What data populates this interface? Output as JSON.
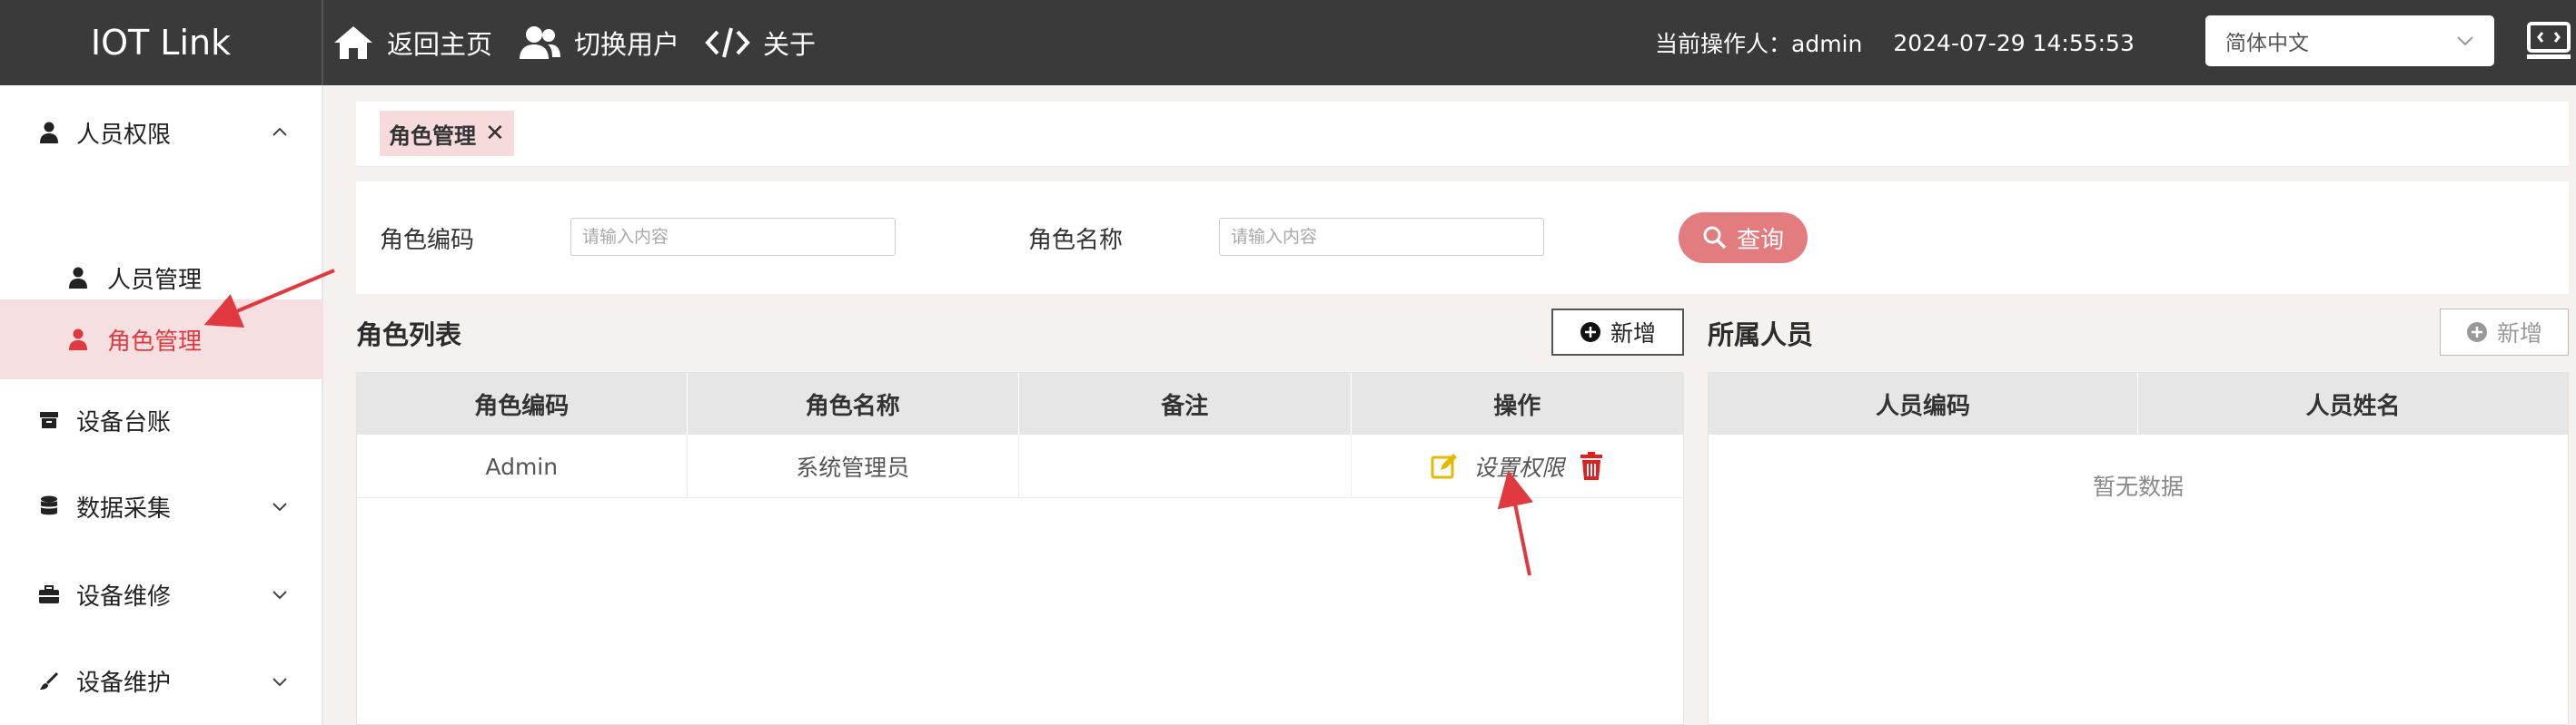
{
  "header": {
    "logo": "IOT Link",
    "nav": [
      {
        "label": "返回主页"
      },
      {
        "label": "切换用户"
      },
      {
        "label": "关于"
      }
    ],
    "operator_label": "当前操作人：admin",
    "datetime": "2024-07-29 14:55:53",
    "language": "简体中文"
  },
  "sidebar": {
    "items": [
      {
        "label": "人员权限"
      },
      {
        "label": "人员管理"
      },
      {
        "label": "角色管理"
      },
      {
        "label": "设备台账"
      },
      {
        "label": "数据采集"
      },
      {
        "label": "设备维修"
      },
      {
        "label": "设备维护"
      }
    ]
  },
  "tabs": [
    {
      "label": "角色管理",
      "close": "✕"
    }
  ],
  "search": {
    "code_label": "角色编码",
    "code_placeholder": "请输入内容",
    "name_label": "角色名称",
    "name_placeholder": "请输入内容",
    "button": "查询"
  },
  "roles": {
    "title": "角色列表",
    "add": "新增",
    "columns": [
      "角色编码",
      "角色名称",
      "备注",
      "操作"
    ],
    "rows": [
      {
        "code": "Admin",
        "name": "系统管理员",
        "remark": "",
        "op": "设置权限"
      }
    ]
  },
  "members": {
    "title": "所属人员",
    "add": "新增",
    "columns": [
      "人员编码",
      "人员姓名"
    ],
    "empty": "暂无数据"
  },
  "colors": {
    "accent": "#e0393f",
    "header_bg": "#3a3a3a",
    "query_btn": "#e27c7f",
    "edit_icon": "#e6b800",
    "delete_icon": "#e02020"
  }
}
